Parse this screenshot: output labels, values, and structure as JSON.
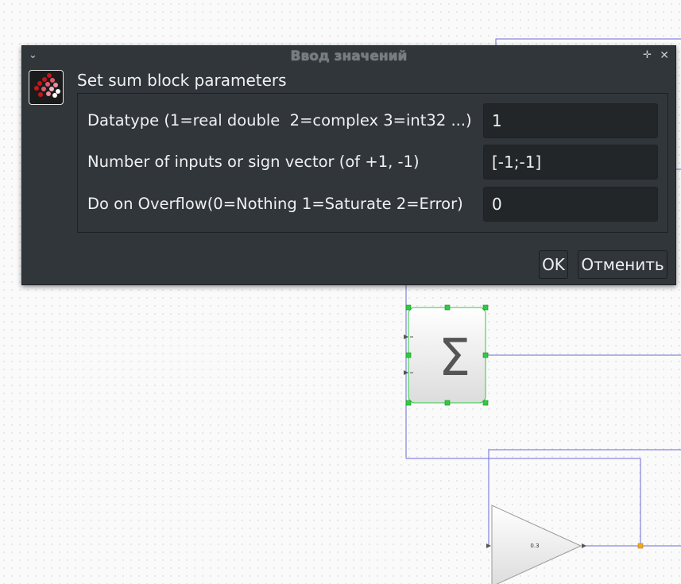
{
  "window": {
    "title": "Ввод значений",
    "menu_icon": "chevron-down-icon",
    "pin_icon": "pin-icon",
    "close_icon": "close-icon"
  },
  "dialog": {
    "heading": "Set sum block parameters",
    "app_icon": "scilab-logo-icon",
    "fields": [
      {
        "label": "Datatype (1=real double  2=complex 3=int32 ...)",
        "value": "1"
      },
      {
        "label": "Number of inputs or sign vector (of +1, -1)",
        "value": "[-1;-1]"
      },
      {
        "label": "Do on Overflow(0=Nothing 1=Saturate 2=Error)",
        "value": "0"
      }
    ],
    "ok_label": "OK",
    "cancel_label": "Отменить"
  },
  "diagram": {
    "sum_block_symbol": "Σ",
    "gain_block_label": "0.3",
    "link_color": "#6b6bd9",
    "selection_color": "#2ecc40",
    "split_point_color": "#f5a623"
  }
}
